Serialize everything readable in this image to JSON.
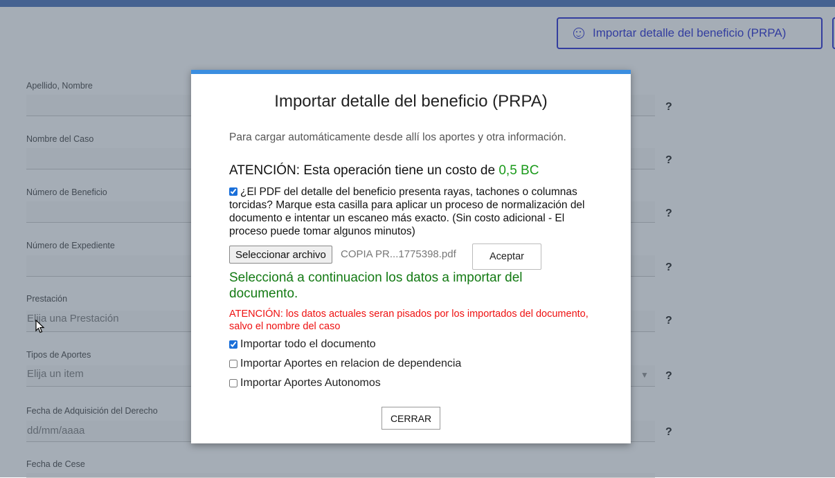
{
  "header": {
    "import_button_label": "Importar detalle del beneficio (PRPA)"
  },
  "form": {
    "fields": [
      {
        "label": "Apellido, Nombre",
        "placeholder": ""
      },
      {
        "label": "Nombre del Caso",
        "placeholder": ""
      },
      {
        "label": "Número de Beneficio",
        "placeholder": ""
      },
      {
        "label": "Número de Expediente",
        "placeholder": ""
      },
      {
        "label": "Prestación",
        "placeholder": "Elija una Prestación"
      },
      {
        "label": "Tipos de Aportes",
        "placeholder": "Elija un item"
      },
      {
        "label": "Fecha de Adquisición del Derecho",
        "placeholder": "dd/mm/aaaa"
      },
      {
        "label": "Fecha de Cese",
        "placeholder": ""
      }
    ],
    "help_glyph": "?",
    "select_caret": "▼"
  },
  "modal": {
    "title": "Importar detalle del beneficio (PRPA)",
    "subtitle": "Para cargar automáticamente desde allí los aportes y otra información.",
    "warning_prefix": "ATENCIÓN: Esta operación tiene un costo de ",
    "warning_cost": "0,5 BC",
    "normalize_checked": true,
    "normalize_text": "¿El PDF del detalle del beneficio presenta rayas, tachones o columnas torcidas? Marque esta casilla para aplicar un proceso de normalización del documento e intentar un escaneo más exacto. (Sin costo adicional - El proceso puede tomar algunos minutos)",
    "file_button_label": "Seleccionar archivo",
    "file_name": "COPIA PR...1775398.pdf",
    "accept_label": "Aceptar",
    "select_prompt": "Seleccioná a continuacion los datos a importar del documento.",
    "overwrite_warning": "ATENCIÓN: los datos actuales seran pisados por los importados del documento, salvo el nombre del caso",
    "options": [
      {
        "label": "Importar todo el documento",
        "checked": true
      },
      {
        "label": "Importar Aportes en relacion de dependencia",
        "checked": false
      },
      {
        "label": "Importar Aportes Autonomos",
        "checked": false
      }
    ],
    "close_label": "CERRAR"
  },
  "colors": {
    "accent_blue": "#3b3fd8",
    "cost_green": "#1a9a1a",
    "prompt_green": "#137a13",
    "warning_red": "#ee1010"
  }
}
